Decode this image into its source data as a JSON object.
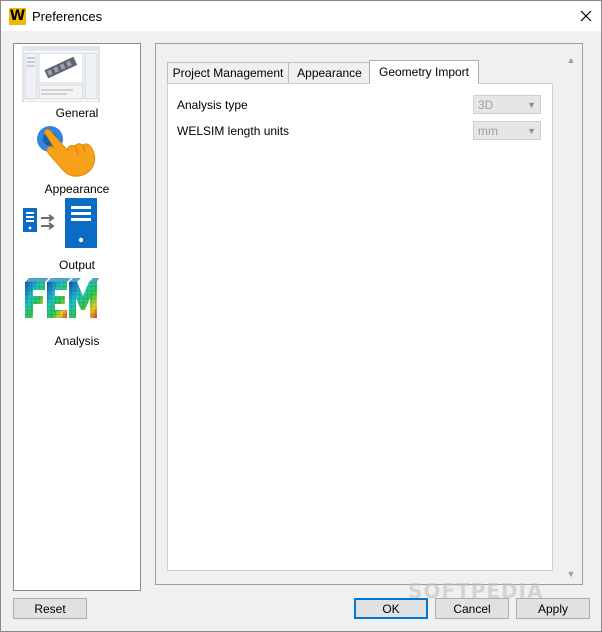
{
  "window": {
    "title": "Preferences",
    "logo_letter": "W"
  },
  "sidebar": {
    "items": [
      {
        "label": "General",
        "icon": "general-screenshot-icon"
      },
      {
        "label": "Appearance",
        "icon": "pointing-hand-icon"
      },
      {
        "label": "Output",
        "icon": "document-server-icon"
      },
      {
        "label": "Analysis",
        "icon": "fem-mesh-icon"
      }
    ]
  },
  "tabs": [
    {
      "label": "Project Management",
      "active": false
    },
    {
      "label": "Appearance",
      "active": false
    },
    {
      "label": "Geometry Import",
      "active": true
    }
  ],
  "geometry_import": {
    "analysis_type": {
      "label": "Analysis type",
      "value": "3D"
    },
    "length_units": {
      "label": "WELSIM length units",
      "value": "mm"
    }
  },
  "buttons": {
    "reset": "Reset",
    "ok": "OK",
    "cancel": "Cancel",
    "apply": "Apply"
  },
  "watermark": "SOFTPEDIA",
  "colors": {
    "logo": "#f5b800",
    "accent": "#0078d7",
    "hand": "#f7a11b",
    "output_blue": "#0a6cc4"
  }
}
